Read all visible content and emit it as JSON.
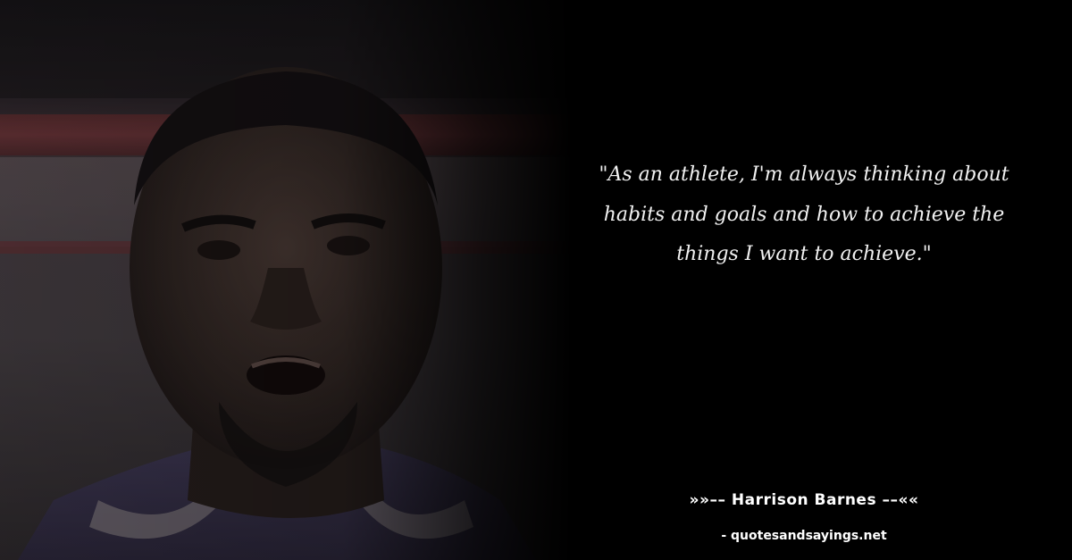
{
  "quote": {
    "text": "\"As an athlete, I'm always thinking about habits and goals and how to achieve the things I want to achieve.\""
  },
  "author": {
    "prefix": "»»–– ",
    "name": "Harrison Barnes",
    "suffix": " ––««"
  },
  "source": {
    "prefix": "- ",
    "site": "quotesandsayings.net"
  }
}
